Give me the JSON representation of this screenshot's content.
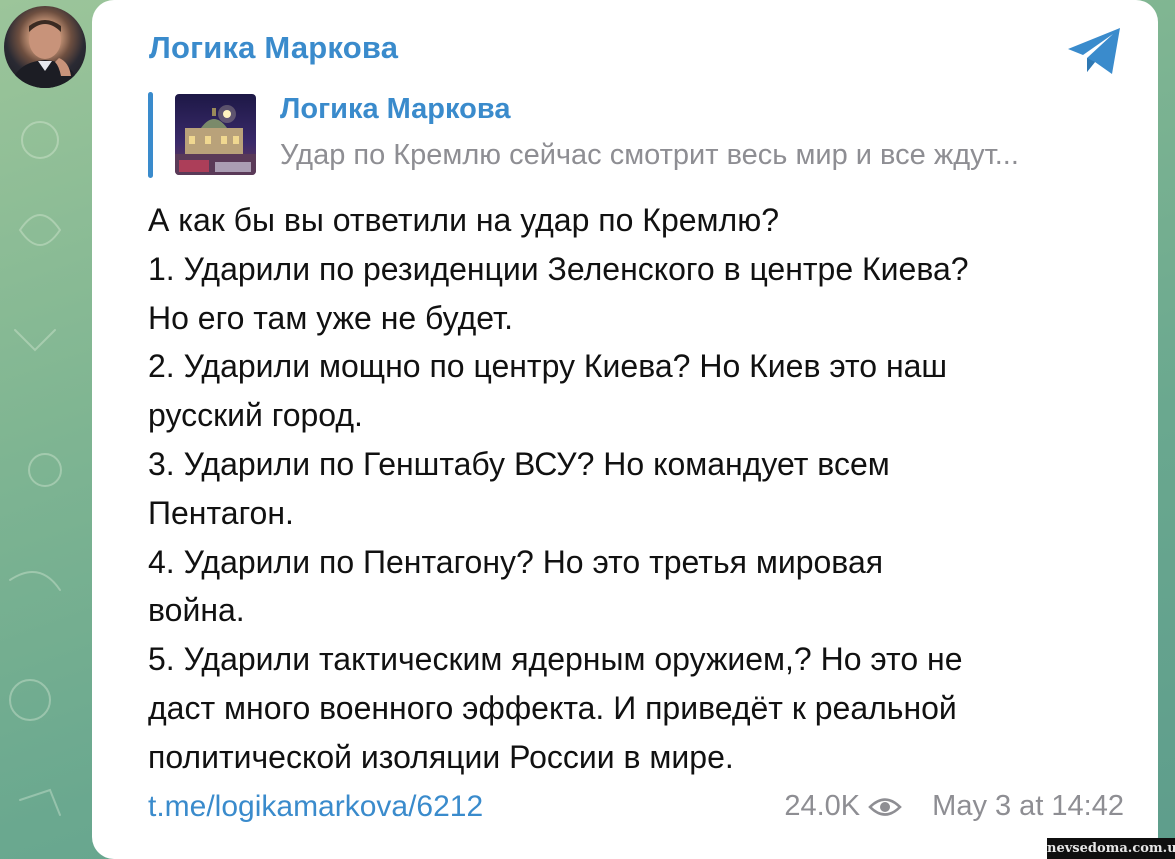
{
  "post": {
    "channel_name": "Логика Маркова",
    "reply": {
      "title": "Логика Маркова",
      "text": "Удар по Кремлю сейчас смотрит весь мир и все ждут..."
    },
    "lines": [
      "А как бы вы ответили на удар по Кремлю?",
      "1. Ударили по резиденции Зеленского в центре Киева?",
      "Но его там уже не будет.",
      "2. Ударили мощно по центру Киева? Но Киев это наш",
      "русский город.",
      "3. Ударили по Генштабу ВСУ? Но командует всем",
      "Пентагон.",
      "4. Ударили по Пентагону? Но это третья мировая",
      "война.",
      "5. Ударили тактическим ядерным оружием,? Но это не",
      "даст много военного эффекта. И приведёт к реальной",
      "политической изоляции России в мире."
    ],
    "link": "t.me/logikamarkova/6212",
    "views": "24.0K",
    "timestamp": "May 3 at 14:42"
  },
  "watermark": "nevsedoma.com.ua",
  "icons": {
    "share": "telegram-share-icon",
    "views": "eye-icon"
  },
  "colors": {
    "accent": "#3a8bcc",
    "secondary_text": "#8e8e93",
    "main_text": "#111111",
    "bubble": "#ffffff",
    "background": "#7fb592"
  }
}
